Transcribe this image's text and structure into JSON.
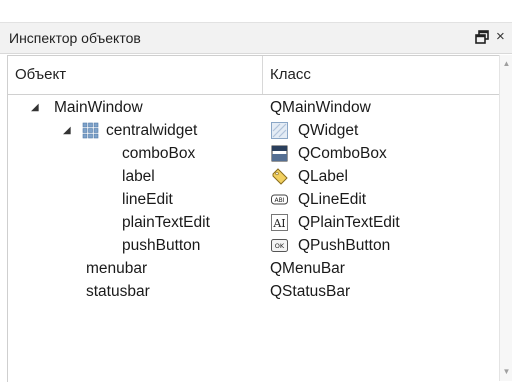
{
  "panel": {
    "title": "Инспектор объектов",
    "float_icon": "float-window-icon",
    "close_glyph": "×"
  },
  "tree": {
    "columns": [
      "Объект",
      "Класс"
    ],
    "rows": [
      {
        "object": "MainWindow",
        "class": "QMainWindow",
        "expanded": true,
        "icon": ""
      },
      {
        "object": "centralwidget",
        "class": "QWidget",
        "expanded": true,
        "icon": "grid-layout-icon",
        "class_icon": "widget-icon"
      },
      {
        "object": "comboBox",
        "class": "QComboBox",
        "class_icon": "combobox-icon"
      },
      {
        "object": "label",
        "class": "QLabel",
        "class_icon": "label-tag-icon"
      },
      {
        "object": "lineEdit",
        "class": "QLineEdit",
        "class_icon": "lineedit-icon"
      },
      {
        "object": "plainTextEdit",
        "class": "QPlainTextEdit",
        "class_icon": "plaintextedit-icon"
      },
      {
        "object": "pushButton",
        "class": "QPushButton",
        "class_icon": "pushbutton-icon"
      },
      {
        "object": "menubar",
        "class": "QMenuBar"
      },
      {
        "object": "statusbar",
        "class": "QStatusBar"
      }
    ],
    "lineedit_icon_text": "ABI",
    "plaintext_icon_text": "AI",
    "pushbutton_icon_text": "OK"
  },
  "colors": {
    "titlebar_bg": "#f2f2f2",
    "border": "#cfcfcf",
    "text": "#1a1a1a"
  }
}
